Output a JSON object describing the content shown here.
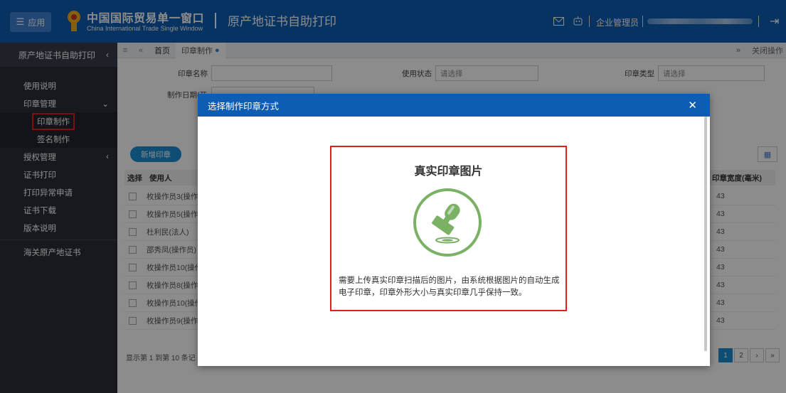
{
  "header": {
    "app_button": "应用",
    "brand_cn": "中国国际贸易单一窗口",
    "brand_en": "China International Trade Single Window",
    "page_title": "原产地证书自助打印",
    "role": "企业管理员"
  },
  "sidebar": {
    "title": "原产地证书自助打印",
    "items": [
      {
        "label": "使用说明"
      },
      {
        "label": "印章管理"
      },
      {
        "label": "印章制作"
      },
      {
        "label": "签名制作"
      },
      {
        "label": "授权管理"
      },
      {
        "label": "证书打印"
      },
      {
        "label": "打印异常申请"
      },
      {
        "label": "证书下载"
      },
      {
        "label": "版本说明"
      },
      {
        "label": "海关原产地证书"
      }
    ]
  },
  "tabs": {
    "home": "首页",
    "current": "印章制作",
    "close_ops": "关闭操作"
  },
  "content": {
    "field_seal_name": "印章名称",
    "field_status": "使用状态",
    "field_status_placeholder": "请选择",
    "field_seal_type": "印章类型",
    "field_type_placeholder": "请选择",
    "field_make_date": "制作日期(开",
    "add_button": "新增印章",
    "col_select": "选择",
    "col_user": "使用人",
    "col_width": "印章宽度(毫米)",
    "rows": [
      {
        "user": "枚操作员3(操作",
        "width": "43"
      },
      {
        "user": "枚操作员5(操作",
        "width": "43"
      },
      {
        "user": "杜利民(法人)",
        "width": "43"
      },
      {
        "user": "邵秀凤(操作员)",
        "width": "43"
      },
      {
        "user": "枚操作员10(操作",
        "width": "43"
      },
      {
        "user": "枚操作员8(操作",
        "width": "43"
      },
      {
        "user": "枚操作员10(操作",
        "width": "43"
      },
      {
        "user": "枚操作员9(操作",
        "width": "43"
      }
    ],
    "footer_info": "显示第 1 到第 10 条记",
    "pager": [
      "1",
      "2",
      "›",
      "»"
    ]
  },
  "modal": {
    "title": "选择制作印章方式",
    "option_title": "真实印章图片",
    "option_desc": "需要上传真实印章扫描后的图片，由系统根据图片的自动生成电子印章，印章外形大小与真实印章几乎保持一致。",
    "icon": "stamp-icon",
    "colors": {
      "accent": "#0c5db3",
      "icon_green": "#7bb165",
      "highlight": "#e02020"
    }
  }
}
